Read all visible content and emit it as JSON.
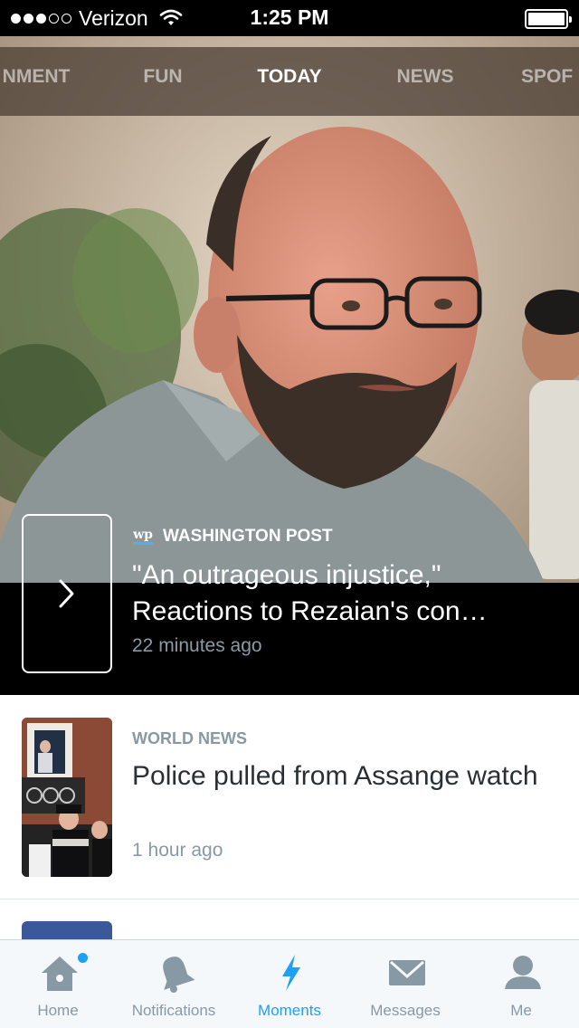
{
  "status_bar": {
    "carrier": "Verizon",
    "time": "1:25 PM",
    "signal_bars_filled": 3,
    "signal_bars_total": 5
  },
  "category_tabs": [
    {
      "label": "NMENT",
      "active": false
    },
    {
      "label": "FUN",
      "active": false
    },
    {
      "label": "TODAY",
      "active": true
    },
    {
      "label": "NEWS",
      "active": false
    },
    {
      "label": "SPOF",
      "active": false
    }
  ],
  "hero": {
    "source": "WASHINGTON POST",
    "source_logo_text": "wp",
    "headline_line1": "\"An outrageous injustice,\"",
    "headline_line2": "Reactions to Rezaian's con…",
    "time": "22 minutes ago"
  },
  "story": {
    "category": "WORLD NEWS",
    "title": "Police pulled from Assange watch",
    "time": "1 hour ago"
  },
  "tab_bar": {
    "items": [
      {
        "label": "Home",
        "icon": "home-icon",
        "active": false,
        "badge": true
      },
      {
        "label": "Notifications",
        "icon": "bell-icon",
        "active": false
      },
      {
        "label": "Moments",
        "icon": "lightning-icon",
        "active": true
      },
      {
        "label": "Messages",
        "icon": "envelope-icon",
        "active": false
      },
      {
        "label": "Me",
        "icon": "person-icon",
        "active": false
      }
    ]
  },
  "colors": {
    "accent": "#1da1f2",
    "inactive": "#8899a6",
    "text": "#292f33"
  }
}
